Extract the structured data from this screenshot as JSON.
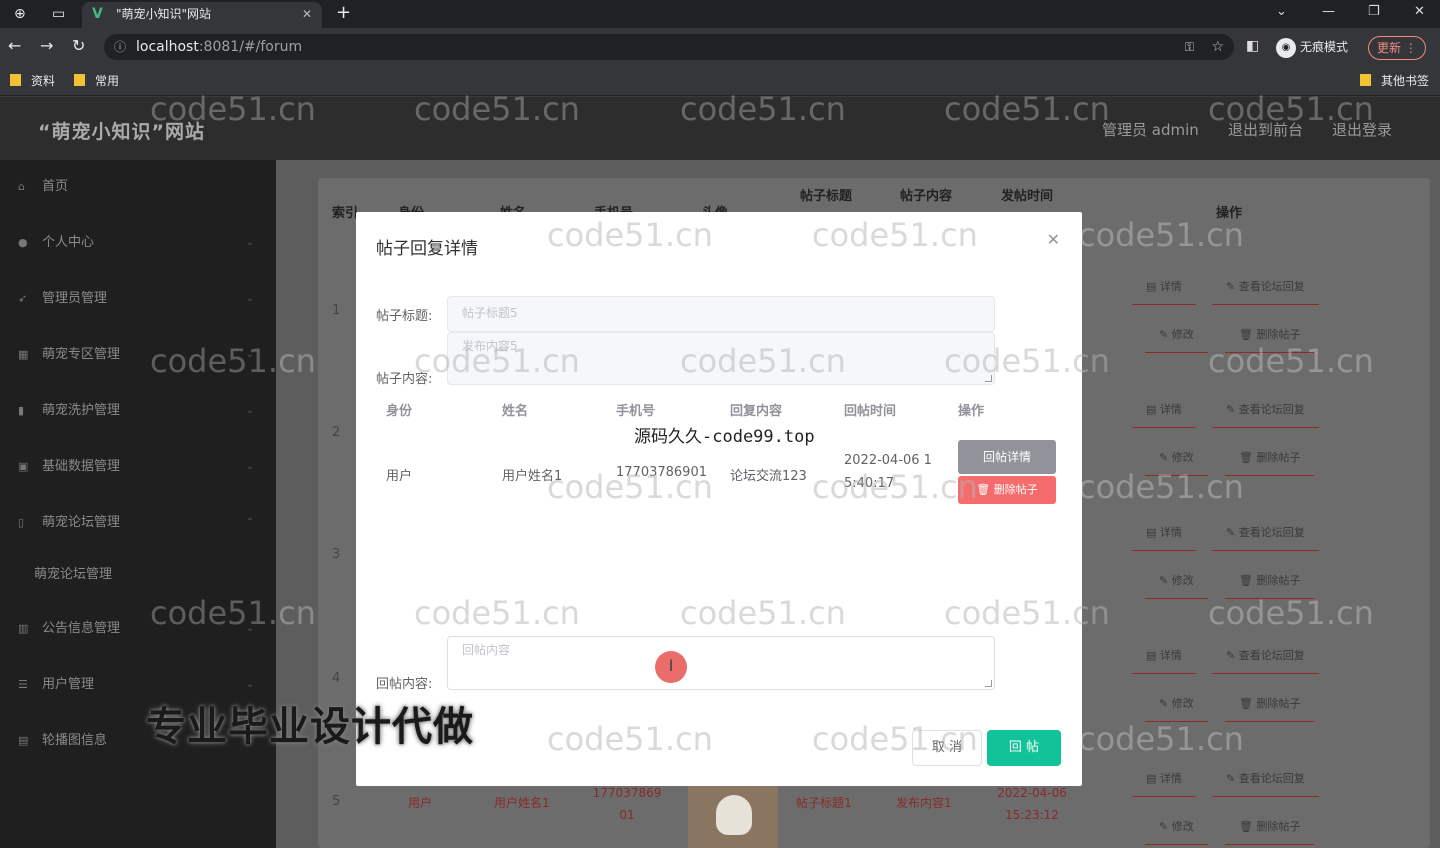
{
  "browser": {
    "tab_title": "\"萌宠小知识\"网站",
    "new_tab": "+",
    "url_host": "localhost",
    "url_rest": ":8081/#/forum",
    "incognito_label": "无痕模式",
    "update_label": "更新",
    "bookmarks": [
      "资料",
      "常用"
    ],
    "other_bookmarks": "其他书签"
  },
  "header": {
    "brand": "“萌宠小知识”网站",
    "admin": "管理员 admin",
    "back_front": "退出到前台",
    "logout": "退出登录"
  },
  "sidebar": {
    "items": [
      {
        "label": "首页",
        "icon": "home-icon"
      },
      {
        "label": "个人中心",
        "icon": "user-icon"
      },
      {
        "label": "管理员管理",
        "icon": "send-icon"
      },
      {
        "label": "萌宠专区管理",
        "icon": "grid-icon"
      },
      {
        "label": "萌宠洗护管理",
        "icon": "chart-icon"
      },
      {
        "label": "基础数据管理",
        "icon": "data-icon"
      },
      {
        "label": "萌宠论坛管理",
        "icon": "phone-icon"
      },
      {
        "label": "萌宠论坛管理",
        "icon": ""
      },
      {
        "label": "公告信息管理",
        "icon": "bar-icon"
      },
      {
        "label": "用户管理",
        "icon": "list-icon"
      },
      {
        "label": "轮播图信息",
        "icon": "picture-icon"
      }
    ]
  },
  "table": {
    "headers": [
      "索引",
      "身份",
      "姓名",
      "手机号",
      "头像",
      "帖子标题",
      "帖子内容",
      "发帖时间",
      "操作"
    ],
    "row_indexes": [
      "1",
      "2",
      "3",
      "4",
      "5"
    ],
    "ops": {
      "detail": "详情",
      "view_replies": "查看论坛回复",
      "edit": "修改",
      "delete": "删除帖子"
    },
    "row5": {
      "identity": "用户",
      "name": "用户姓名1",
      "phone": "17703786901",
      "title": "帖子标题1",
      "content": "发布内容1",
      "time": "2022-04-06 15:23:12"
    }
  },
  "modal": {
    "title": "帖子回复详情",
    "title_label": "帖子标题:",
    "title_placeholder": "帖子标题5",
    "content_label": "帖子内容:",
    "content_placeholder": "发布内容5",
    "reply_headers": [
      "身份",
      "姓名",
      "手机号",
      "回复内容",
      "回帖时间",
      "操作"
    ],
    "reply_row": {
      "identity": "用户",
      "name": "用户姓名1",
      "phone": "17703786901",
      "content": "论坛交流123",
      "time_line1": "2022-04-06 1",
      "time_line2": "5:40:17"
    },
    "btn_detail": "回帖详情",
    "btn_delete": "删除帖子",
    "reply_label": "回帖内容:",
    "reply_placeholder": "回帖内容",
    "cancel": "取 消",
    "submit": "回 帖"
  },
  "overlay": {
    "caption": "源码久久-code99.top",
    "banner": "专业毕业设计代做",
    "watermark": "code51.cn"
  }
}
